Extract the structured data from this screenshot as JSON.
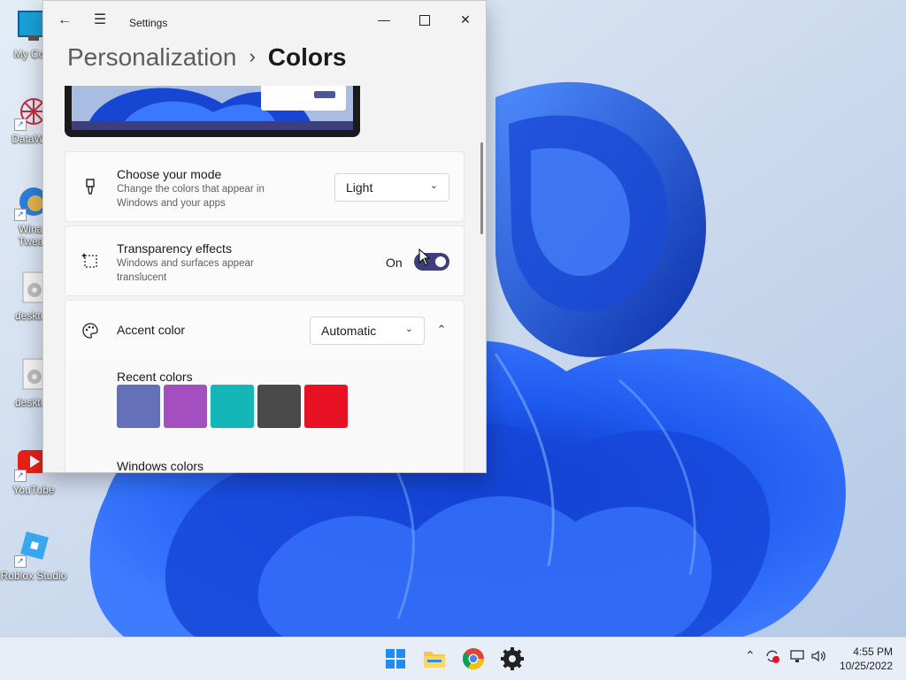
{
  "window": {
    "app_title": "Settings",
    "breadcrumb_parent": "Personalization",
    "breadcrumb_separator": "›",
    "breadcrumb_current": "Colors"
  },
  "mode": {
    "title": "Choose your mode",
    "description": "Change the colors that appear in Windows and your apps",
    "value": "Light"
  },
  "transparency": {
    "title": "Transparency effects",
    "description": "Windows and surfaces appear translucent",
    "state_label": "On",
    "enabled": true
  },
  "accent": {
    "title": "Accent color",
    "value": "Automatic",
    "recent_label": "Recent colors",
    "recent_colors": [
      "#6470b8",
      "#a44fc0",
      "#14b6b8",
      "#4a4a4a",
      "#e81123"
    ],
    "windows_label": "Windows colors"
  },
  "desktop_icons": [
    {
      "label": "My Com",
      "icon": "computer-icon"
    },
    {
      "label": "DataWag",
      "icon": "datawag-icon"
    },
    {
      "label": "Winae\nTweak",
      "icon": "winaero-icon"
    },
    {
      "label": "desktop",
      "icon": "gear-file-icon"
    },
    {
      "label": "desktop",
      "icon": "gear-file-icon"
    },
    {
      "label": "YouTube",
      "icon": "youtube-icon"
    },
    {
      "label": "Roblox Studio",
      "icon": "roblox-studio-icon"
    }
  ],
  "taskbar": {
    "apps": [
      "start-icon",
      "file-explorer-icon",
      "chrome-icon",
      "settings-icon"
    ],
    "time": "4:55 PM",
    "date": "10/25/2022"
  }
}
